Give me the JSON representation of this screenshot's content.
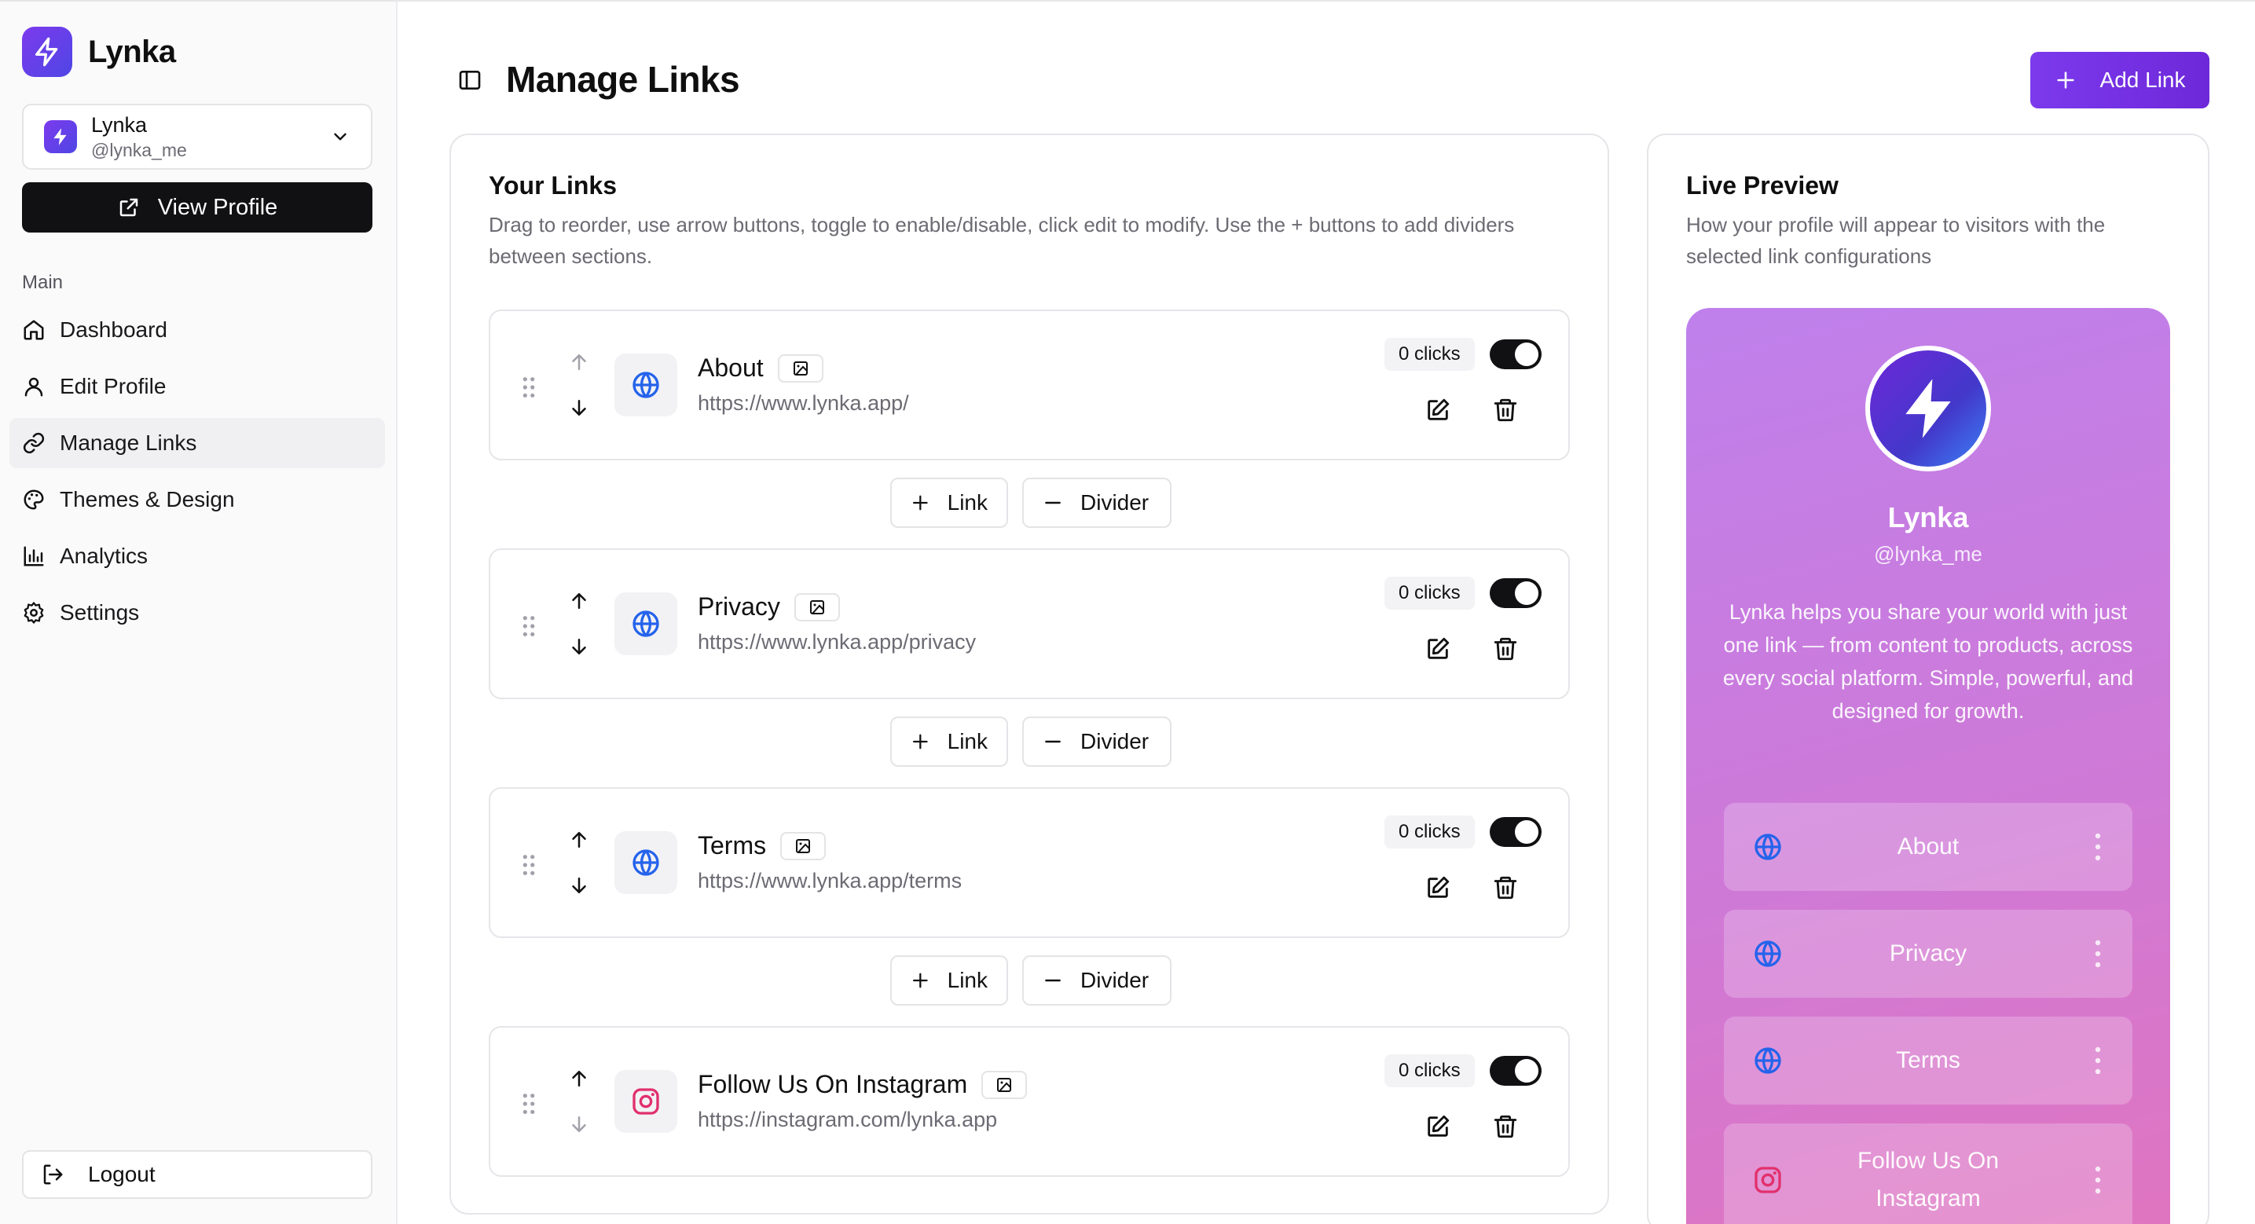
{
  "app": {
    "name": "Lynka"
  },
  "profile": {
    "name": "Lynka",
    "handle": "@lynka_me",
    "view_profile_label": "View Profile"
  },
  "nav": {
    "section_label": "Main",
    "items": [
      {
        "label": "Dashboard",
        "icon": "home-icon"
      },
      {
        "label": "Edit Profile",
        "icon": "user-icon"
      },
      {
        "label": "Manage Links",
        "icon": "link-icon",
        "active": true
      },
      {
        "label": "Themes & Design",
        "icon": "palette-icon"
      },
      {
        "label": "Analytics",
        "icon": "bar-chart-icon"
      },
      {
        "label": "Settings",
        "icon": "gear-icon"
      }
    ],
    "logout_label": "Logout"
  },
  "header": {
    "title": "Manage Links",
    "add_link_label": "Add Link"
  },
  "links_panel": {
    "title": "Your Links",
    "description": "Drag to reorder, use arrow buttons, toggle to enable/disable, click edit to modify. Use the + buttons to add dividers between sections.",
    "items": [
      {
        "title": "About",
        "url": "https://www.lynka.app/",
        "clicks": "0 clicks",
        "enabled": true,
        "icon": "globe-icon"
      },
      {
        "title": "Privacy",
        "url": "https://www.lynka.app/privacy",
        "clicks": "0 clicks",
        "enabled": true,
        "icon": "globe-icon"
      },
      {
        "title": "Terms",
        "url": "https://www.lynka.app/terms",
        "clicks": "0 clicks",
        "enabled": true,
        "icon": "globe-icon"
      },
      {
        "title": "Follow Us On Instagram",
        "url": "https://instagram.com/lynka.app",
        "clicks": "0 clicks",
        "enabled": true,
        "icon": "instagram-icon"
      }
    ],
    "add_link_label": "Link",
    "add_divider_label": "Divider"
  },
  "preview": {
    "title": "Live Preview",
    "description": "How your profile will appear to visitors with the selected link configurations",
    "name": "Lynka",
    "handle": "@lynka_me",
    "bio": "Lynka helps you share your world with just one link — from content to products, across every social platform. Simple, powerful, and designed for growth.",
    "links": [
      "About",
      "Privacy",
      "Terms",
      "Follow Us On Instagram"
    ]
  },
  "colors": {
    "accent": "#6d28d9",
    "dark": "#111113",
    "globe": "#2563eb",
    "instagram": "#e1306c"
  }
}
